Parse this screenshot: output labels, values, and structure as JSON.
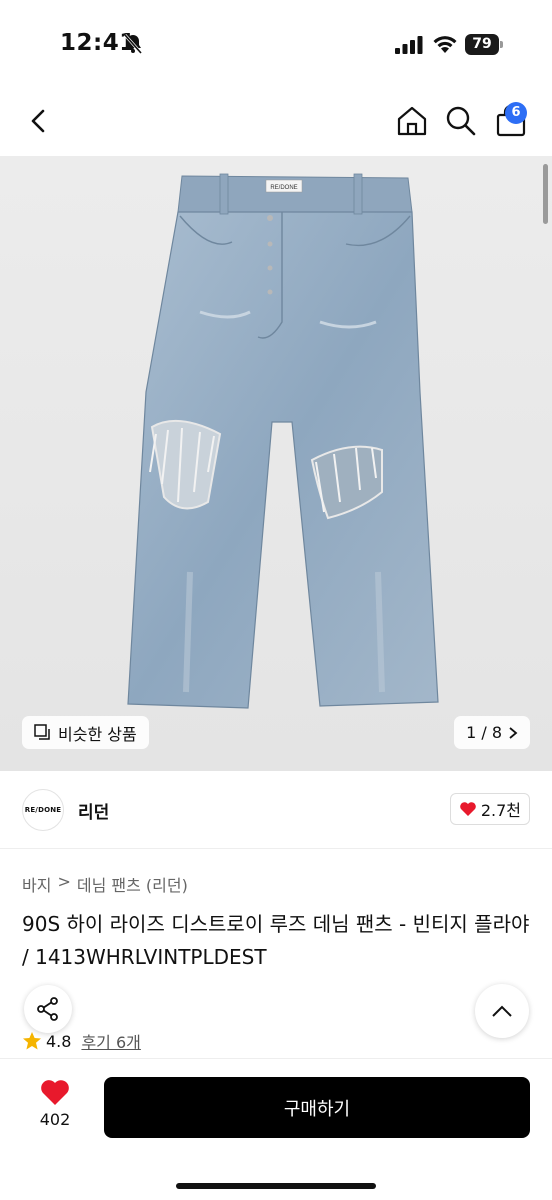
{
  "status_bar": {
    "time": "12:41",
    "battery": "79"
  },
  "nav": {
    "cart_count": "6"
  },
  "gallery": {
    "similar_label": "비슷한 상품",
    "page_indicator": "1 / 8",
    "jeans_patch_text": "RE/DONE"
  },
  "brand": {
    "logo_text": "RE/DONE",
    "name": "리던",
    "likes": "2.7천"
  },
  "breadcrumb": {
    "category": "바지",
    "separator": ">",
    "subcategory": "데님 팬츠 (리던)"
  },
  "product": {
    "title": "90S 하이 라이즈 디스트로이 루즈 데님 팬츠 - 빈티지 플라야 / 1413WHRLVINTPLDEST",
    "rating": "4.8",
    "review_label": "후기 6개"
  },
  "bottom": {
    "wish_count": "402",
    "buy_label": "구매하기"
  },
  "colors": {
    "accent_blue": "#2d6ef5",
    "heart_red": "#e8192c",
    "star_yellow": "#f5b400",
    "buy_button": "#000000"
  }
}
